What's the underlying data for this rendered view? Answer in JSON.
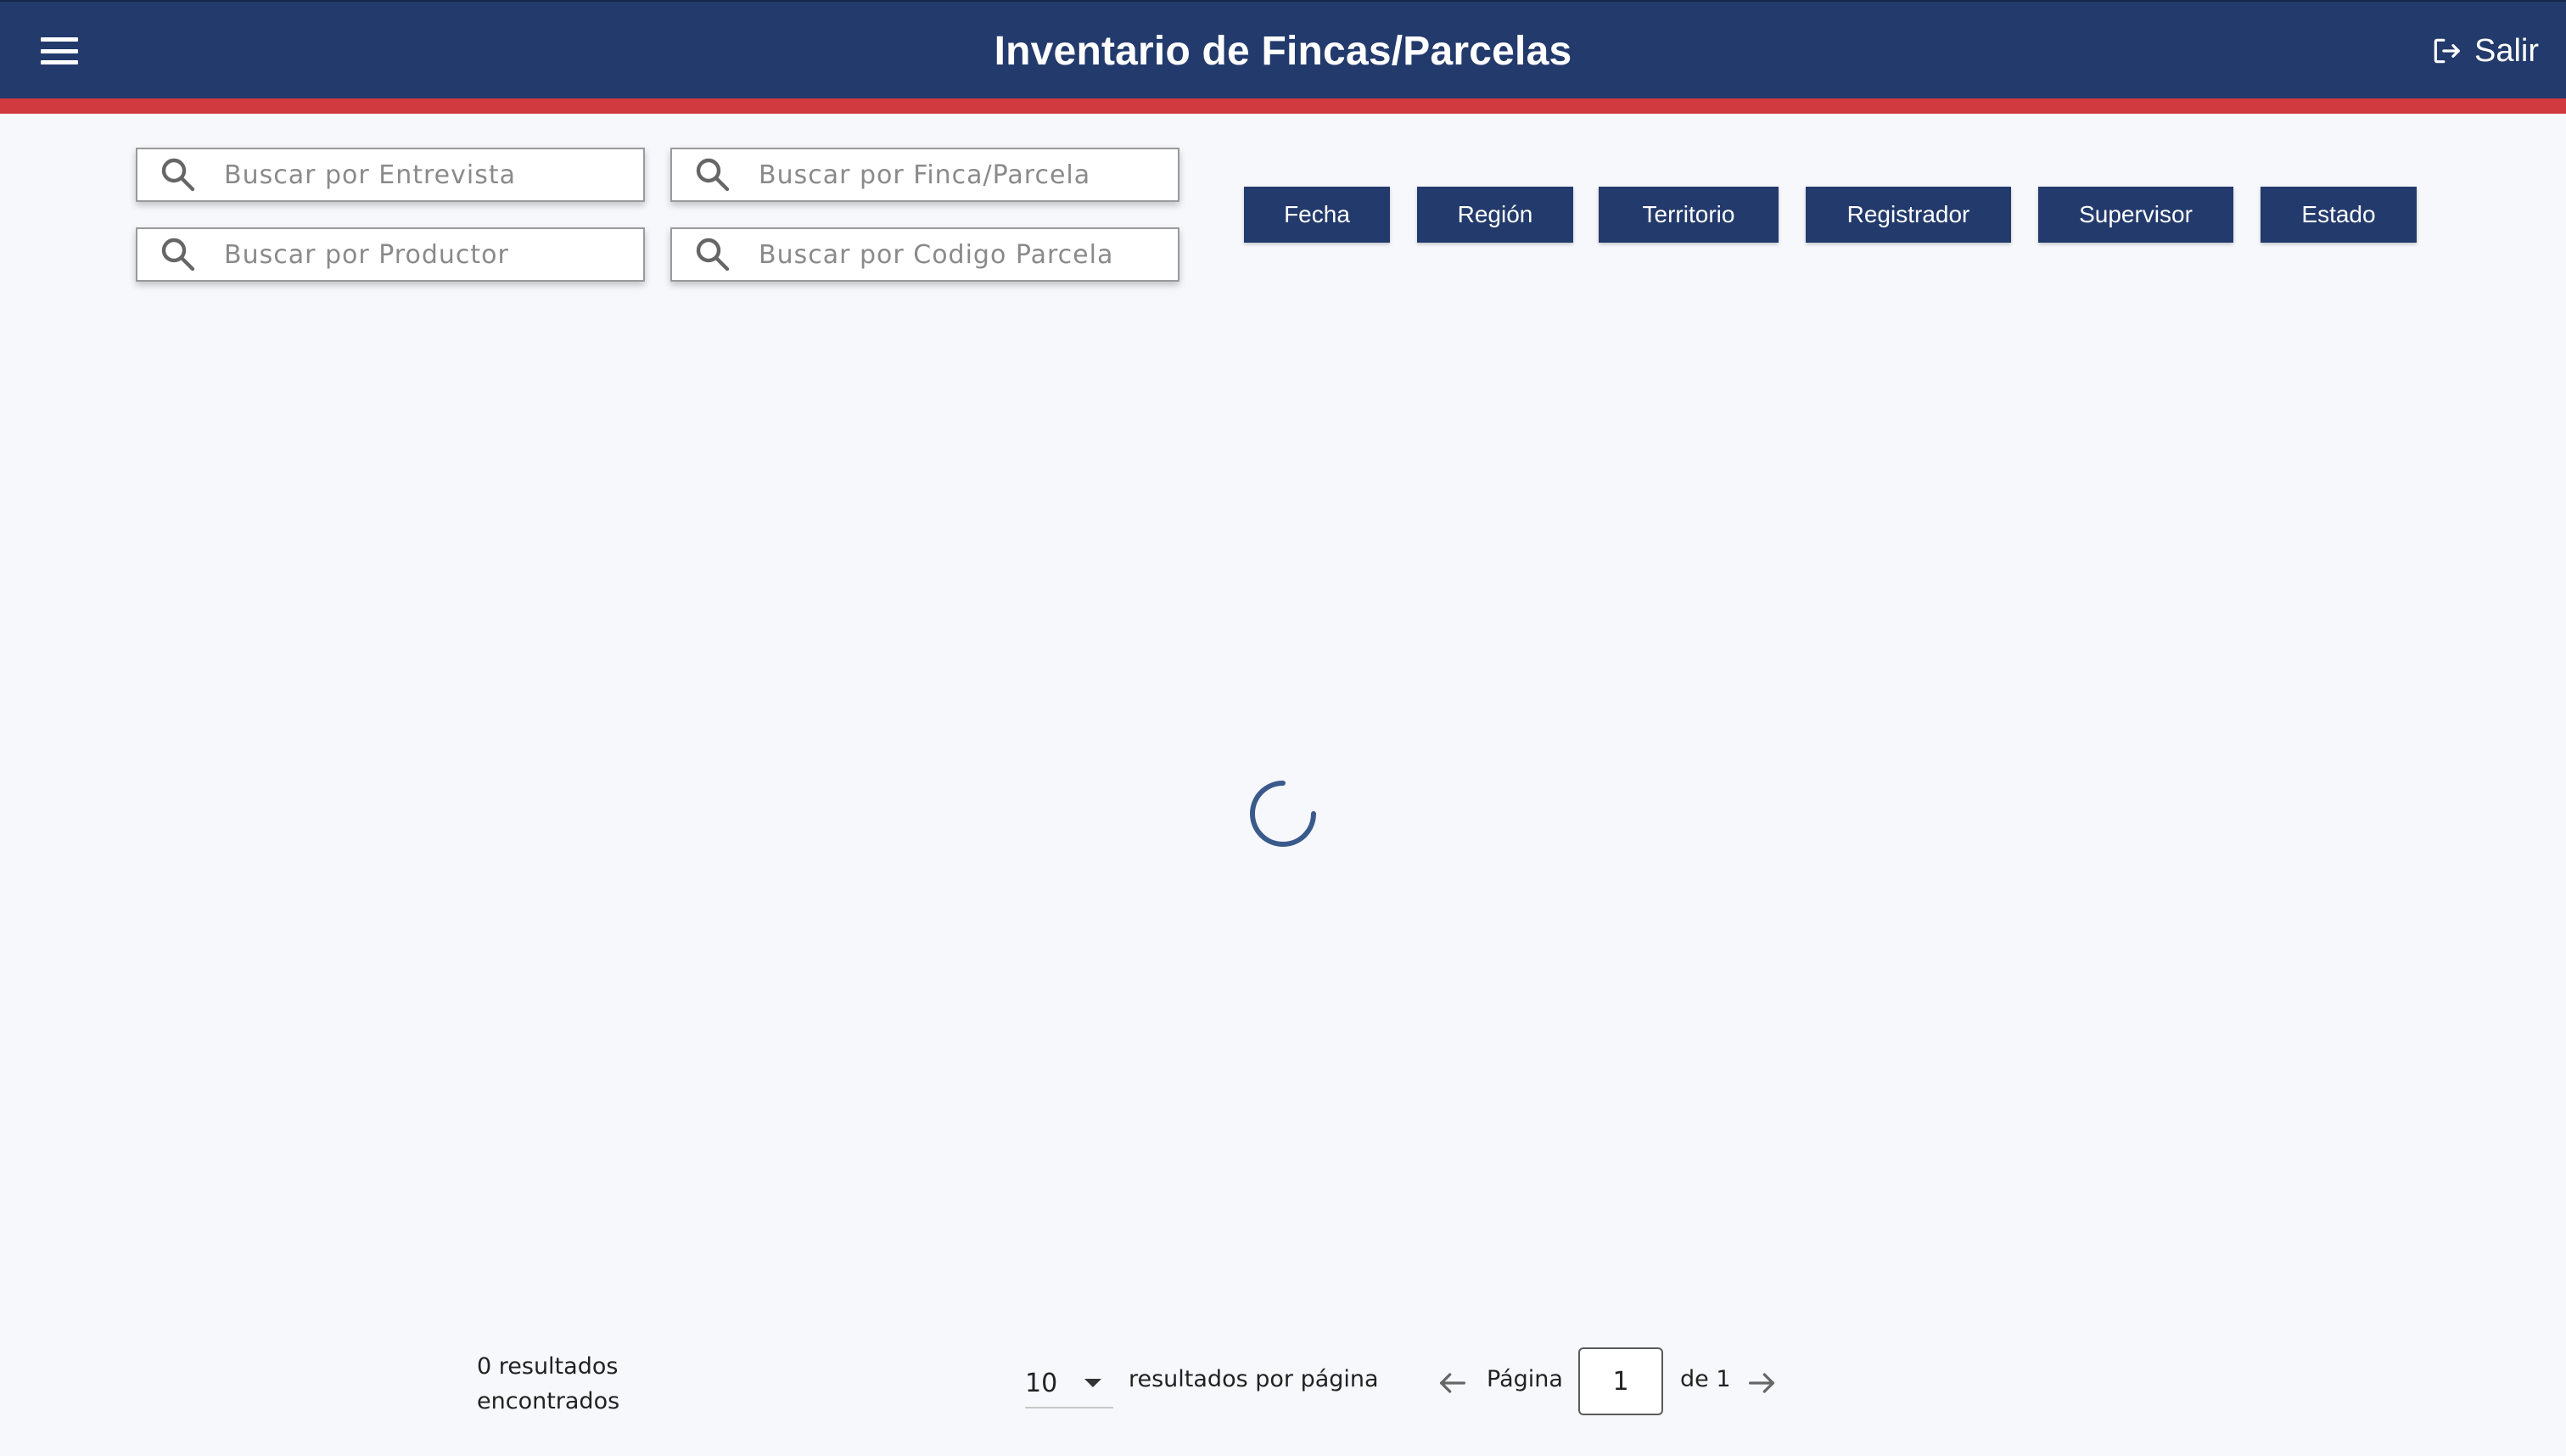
{
  "header": {
    "title": "Inventario de Fincas/Parcelas",
    "logout_label": "Salir",
    "colors": {
      "primary": "#233a6c",
      "accent": "#d13a3f"
    }
  },
  "search": {
    "entrevista_placeholder": "Buscar por Entrevista",
    "finca_placeholder": "Buscar por Finca/Parcela",
    "productor_placeholder": "Buscar por Productor",
    "codigo_placeholder": "Buscar por Codigo Parcela"
  },
  "filters": {
    "fecha": "Fecha",
    "region": "Región",
    "territorio": "Territorio",
    "registrador": "Registrador",
    "supervisor": "Supervisor",
    "estado": "Estado"
  },
  "footer": {
    "results_line1": "0 resultados",
    "results_line2": "encontrados",
    "per_page_value": "10",
    "per_page_label": "resultados por página",
    "page_label": "Página",
    "current_page": "1",
    "page_of": "de 1"
  },
  "icons": {
    "menu": "menu-icon",
    "logout": "logout-icon",
    "search": "search-icon",
    "prev": "arrow-left-icon",
    "next": "arrow-right-icon",
    "loading": "loading-spinner"
  }
}
